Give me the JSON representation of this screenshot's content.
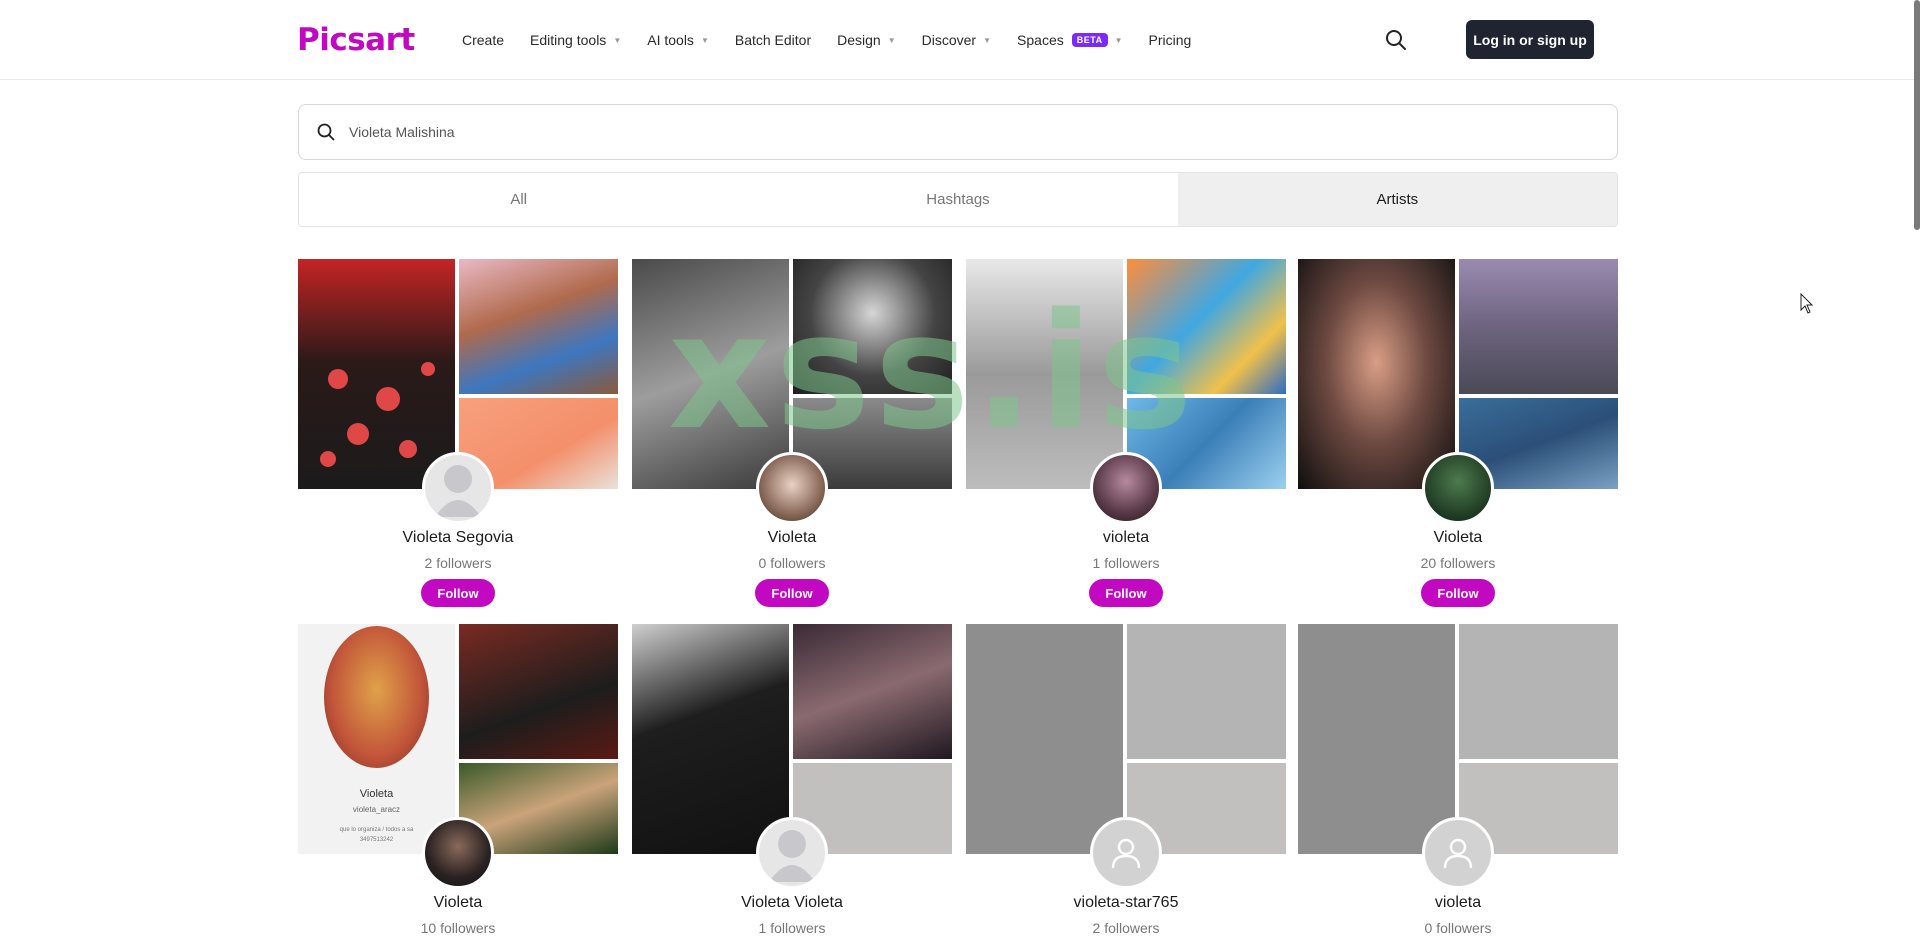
{
  "header": {
    "logo": "Picsart",
    "nav": [
      {
        "label": "Create",
        "caret": false
      },
      {
        "label": "Editing tools",
        "caret": true
      },
      {
        "label": "AI tools",
        "caret": true
      },
      {
        "label": "Batch Editor",
        "caret": false
      },
      {
        "label": "Design",
        "caret": true
      },
      {
        "label": "Discover",
        "caret": true
      },
      {
        "label": "Spaces",
        "caret": true,
        "badge": "BETA"
      },
      {
        "label": "Pricing",
        "caret": false
      }
    ],
    "login_label": "Log in or sign up"
  },
  "search": {
    "value": "Violeta Malishina"
  },
  "tabs": [
    {
      "label": "All",
      "active": false
    },
    {
      "label": "Hashtags",
      "active": false
    },
    {
      "label": "Artists",
      "active": true
    }
  ],
  "artists": [
    {
      "name": "Violeta Segovia",
      "followers": "2 followers",
      "follow_label": "Follow"
    },
    {
      "name": "Violeta",
      "followers": "0 followers",
      "follow_label": "Follow"
    },
    {
      "name": "violeta",
      "followers": "1 followers",
      "follow_label": "Follow"
    },
    {
      "name": "Violeta",
      "followers": "20 followers",
      "follow_label": "Follow"
    },
    {
      "name": "Violeta",
      "followers": "10 followers"
    },
    {
      "name": "Violeta Violeta",
      "followers": "1 followers"
    },
    {
      "name": "violeta-star765",
      "followers": "2 followers"
    },
    {
      "name": "violeta",
      "followers": "0 followers"
    }
  ],
  "collage_text": {
    "name": "Violeta",
    "handle": "violeta_aracz",
    "bio": "que lo organiza / todos a sa",
    "number": "3497513242"
  },
  "watermark": "xss.is",
  "colors": {
    "brand": "#c209c1",
    "login_bg": "#1f2430",
    "beta": "#7a2bf7"
  }
}
